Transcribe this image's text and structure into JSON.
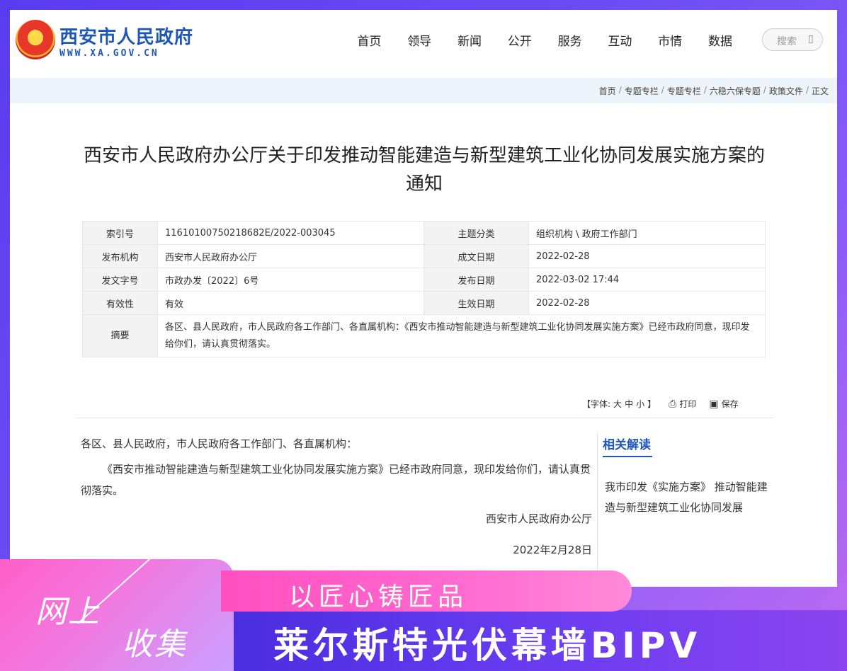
{
  "site": {
    "name_cn": "西安市人民政府",
    "name_en": "WWW.XA.GOV.CN",
    "emblem_icon": "national-emblem-icon"
  },
  "nav": [
    "首页",
    "领导",
    "新闻",
    "公开",
    "服务",
    "互动",
    "市情",
    "数据"
  ],
  "search": {
    "placeholder": "搜索",
    "icon": "search-icon"
  },
  "breadcrumb": [
    "首页",
    "专题专栏",
    "专题专栏",
    "六稳六保专题",
    "政策文件",
    "正文"
  ],
  "article": {
    "title": "西安市人民政府办公厅关于印发推动智能建造与新型建筑工业化协同发展实施方案的通知"
  },
  "info": {
    "index_label": "索引号",
    "index_value": "11610100750218682E/2022-003045",
    "topic_label": "主题分类",
    "topic_value": "组织机构 \\ 政府工作部门",
    "issuer_label": "发布机构",
    "issuer_value": "西安市人民政府办公厅",
    "written_label": "成文日期",
    "written_value": "2022-02-28",
    "docno_label": "发文字号",
    "docno_value": "市政办发〔2022〕6号",
    "publish_label": "发布日期",
    "publish_value": "2022-03-02 17:44",
    "valid_label": "有效性",
    "valid_value": "有效",
    "effective_label": "生效日期",
    "effective_value": "2022-02-28",
    "abstract_label": "摘要",
    "abstract_value": "各区、县人民政府，市人民政府各工作部门、各直属机构：《西安市推动智能建造与新型建筑工业化协同发展实施方案》已经市政府同意，现印发给你们，请认真贯彻落实。"
  },
  "tools": {
    "font_prefix": "【字体:",
    "font_large": "大",
    "font_medium": "中",
    "font_small": "小",
    "font_suffix": "】",
    "print": "打印",
    "save": "保存"
  },
  "body": {
    "greeting": "各区、县人民政府，市人民政府各工作部门、各直属机构：",
    "paragraph": "《西安市推动智能建造与新型建筑工业化协同发展实施方案》已经市政府同意，现印发给你们，请认真贯彻落实。",
    "signer": "西安市人民政府办公厅",
    "date": "2022年2月28日"
  },
  "sidebar": {
    "title": "相关解读",
    "item": "我市印发《实施方案》 推动智能建造与新型建筑工业化协同发展"
  },
  "overlay": {
    "left_line1": "网上",
    "left_line2": "收集",
    "ribbon": "以匠心铸匠品",
    "bottom": "莱尔斯特光伏幕墙BIPV"
  },
  "colors": {
    "brand_blue": "#1e57b8",
    "banner_pink": "#ff4fc0",
    "banner_purple": "#5a3cf0"
  }
}
